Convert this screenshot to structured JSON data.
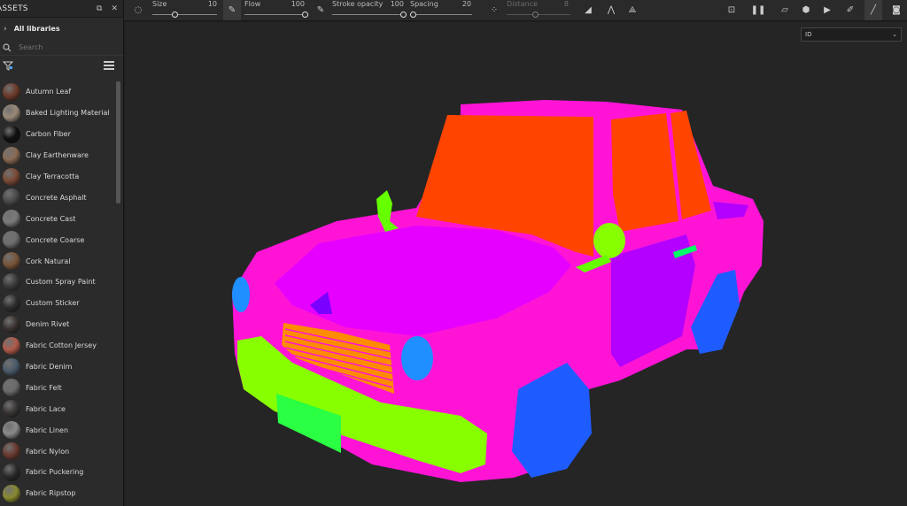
{
  "assets": {
    "title": "ASSETS",
    "libraries_label": "All libraries",
    "search_placeholder": "Search",
    "items": [
      {
        "label": "Autumn Leaf",
        "color": "#6b3a2a"
      },
      {
        "label": "Baked Lighting Material",
        "color": "#9a8a78"
      },
      {
        "label": "Carbon Fiber",
        "color": "#111111"
      },
      {
        "label": "Clay Earthenware",
        "color": "#8a6b55"
      },
      {
        "label": "Clay Terracotta",
        "color": "#7a4a35"
      },
      {
        "label": "Concrete Asphalt",
        "color": "#4a4a4a"
      },
      {
        "label": "Concrete Cast",
        "color": "#7a7a7a"
      },
      {
        "label": "Concrete Coarse",
        "color": "#6e6e6e"
      },
      {
        "label": "Cork Natural",
        "color": "#7a5538"
      },
      {
        "label": "Custom Spray Paint",
        "color": "#3a3a3a"
      },
      {
        "label": "Custom Sticker",
        "color": "#2e2e2e"
      },
      {
        "label": "Denim Rivet",
        "color": "#3a3330"
      },
      {
        "label": "Fabric Cotton Jersey",
        "color": "#b05a4a"
      },
      {
        "label": "Fabric Denim",
        "color": "#4a5a6a"
      },
      {
        "label": "Fabric Felt",
        "color": "#6a6a6a"
      },
      {
        "label": "Fabric Lace",
        "color": "#3a3535"
      },
      {
        "label": "Fabric Linen",
        "color": "#8a8a8a"
      },
      {
        "label": "Fabric Nylon",
        "color": "#6a3a30"
      },
      {
        "label": "Fabric Puckering",
        "color": "#2b2b2b"
      },
      {
        "label": "Fabric Ripstop",
        "color": "#8a8a30"
      }
    ]
  },
  "toolbar": {
    "size": {
      "label": "Size",
      "value": "10",
      "level": 0.35
    },
    "flow": {
      "label": "Flow",
      "value": "100",
      "level": 1.0
    },
    "stroke_opacity": {
      "label": "Stroke opacity",
      "value": "100",
      "level": 1.0
    },
    "spacing": {
      "label": "Spacing",
      "value": "20",
      "level": 0.05
    },
    "distance": {
      "label": "Distance",
      "value": "8",
      "level": 0.45
    }
  },
  "viewport": {
    "channel_select": "ID"
  }
}
